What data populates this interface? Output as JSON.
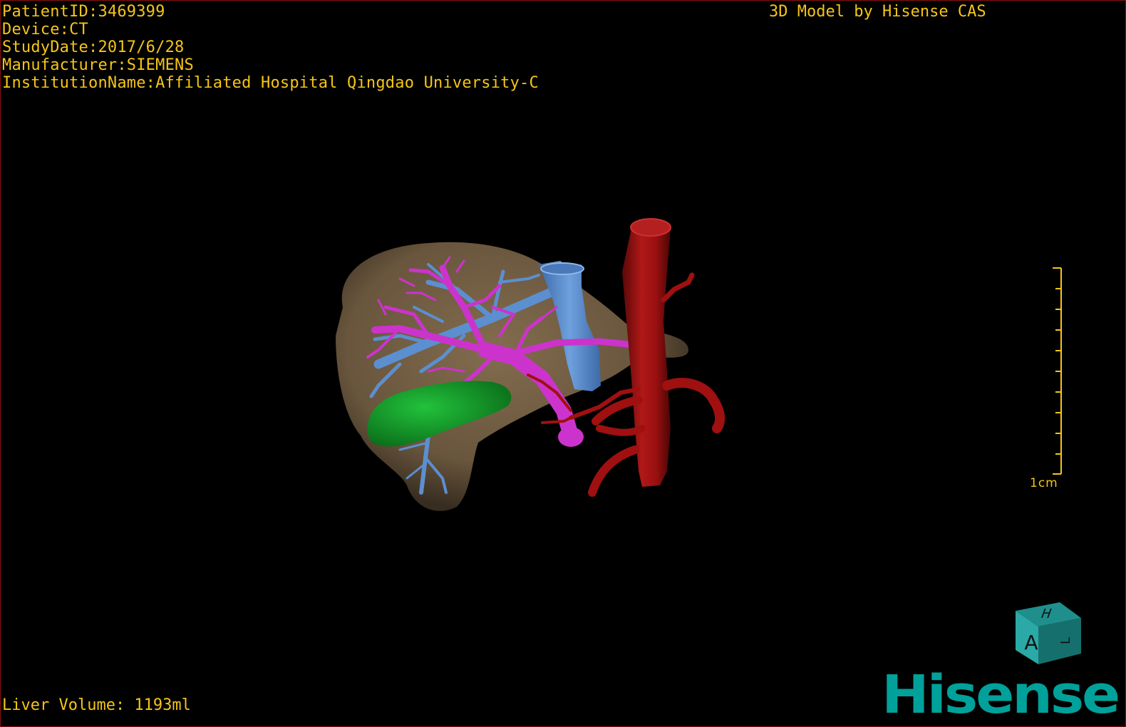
{
  "header": {
    "patient_id": "PatientID:3469399",
    "device": "Device:CT",
    "study_date": "StudyDate:2017/6/28",
    "manufacturer": "Manufacturer:SIEMENS",
    "institution": "InstitutionName:Affiliated Hospital Qingdao University-C"
  },
  "credit": "3D Model by Hisense CAS",
  "footer": {
    "liver_volume": "Liver Volume: 1193ml"
  },
  "scale_bar": {
    "label": "1cm"
  },
  "orientation_cube": {
    "top_label": "H",
    "front_label": "A",
    "side_label": "L"
  },
  "brand": {
    "name": "Hisense",
    "color": "#00a19a"
  },
  "colors": {
    "overlay_text": "#f5c518",
    "liver": "#7a6448",
    "portal_vein": "#cc33cc",
    "hepatic_vein": "#5b8fd0",
    "gallbladder": "#14962a",
    "artery": "#a01010",
    "border": "#8a1010"
  }
}
